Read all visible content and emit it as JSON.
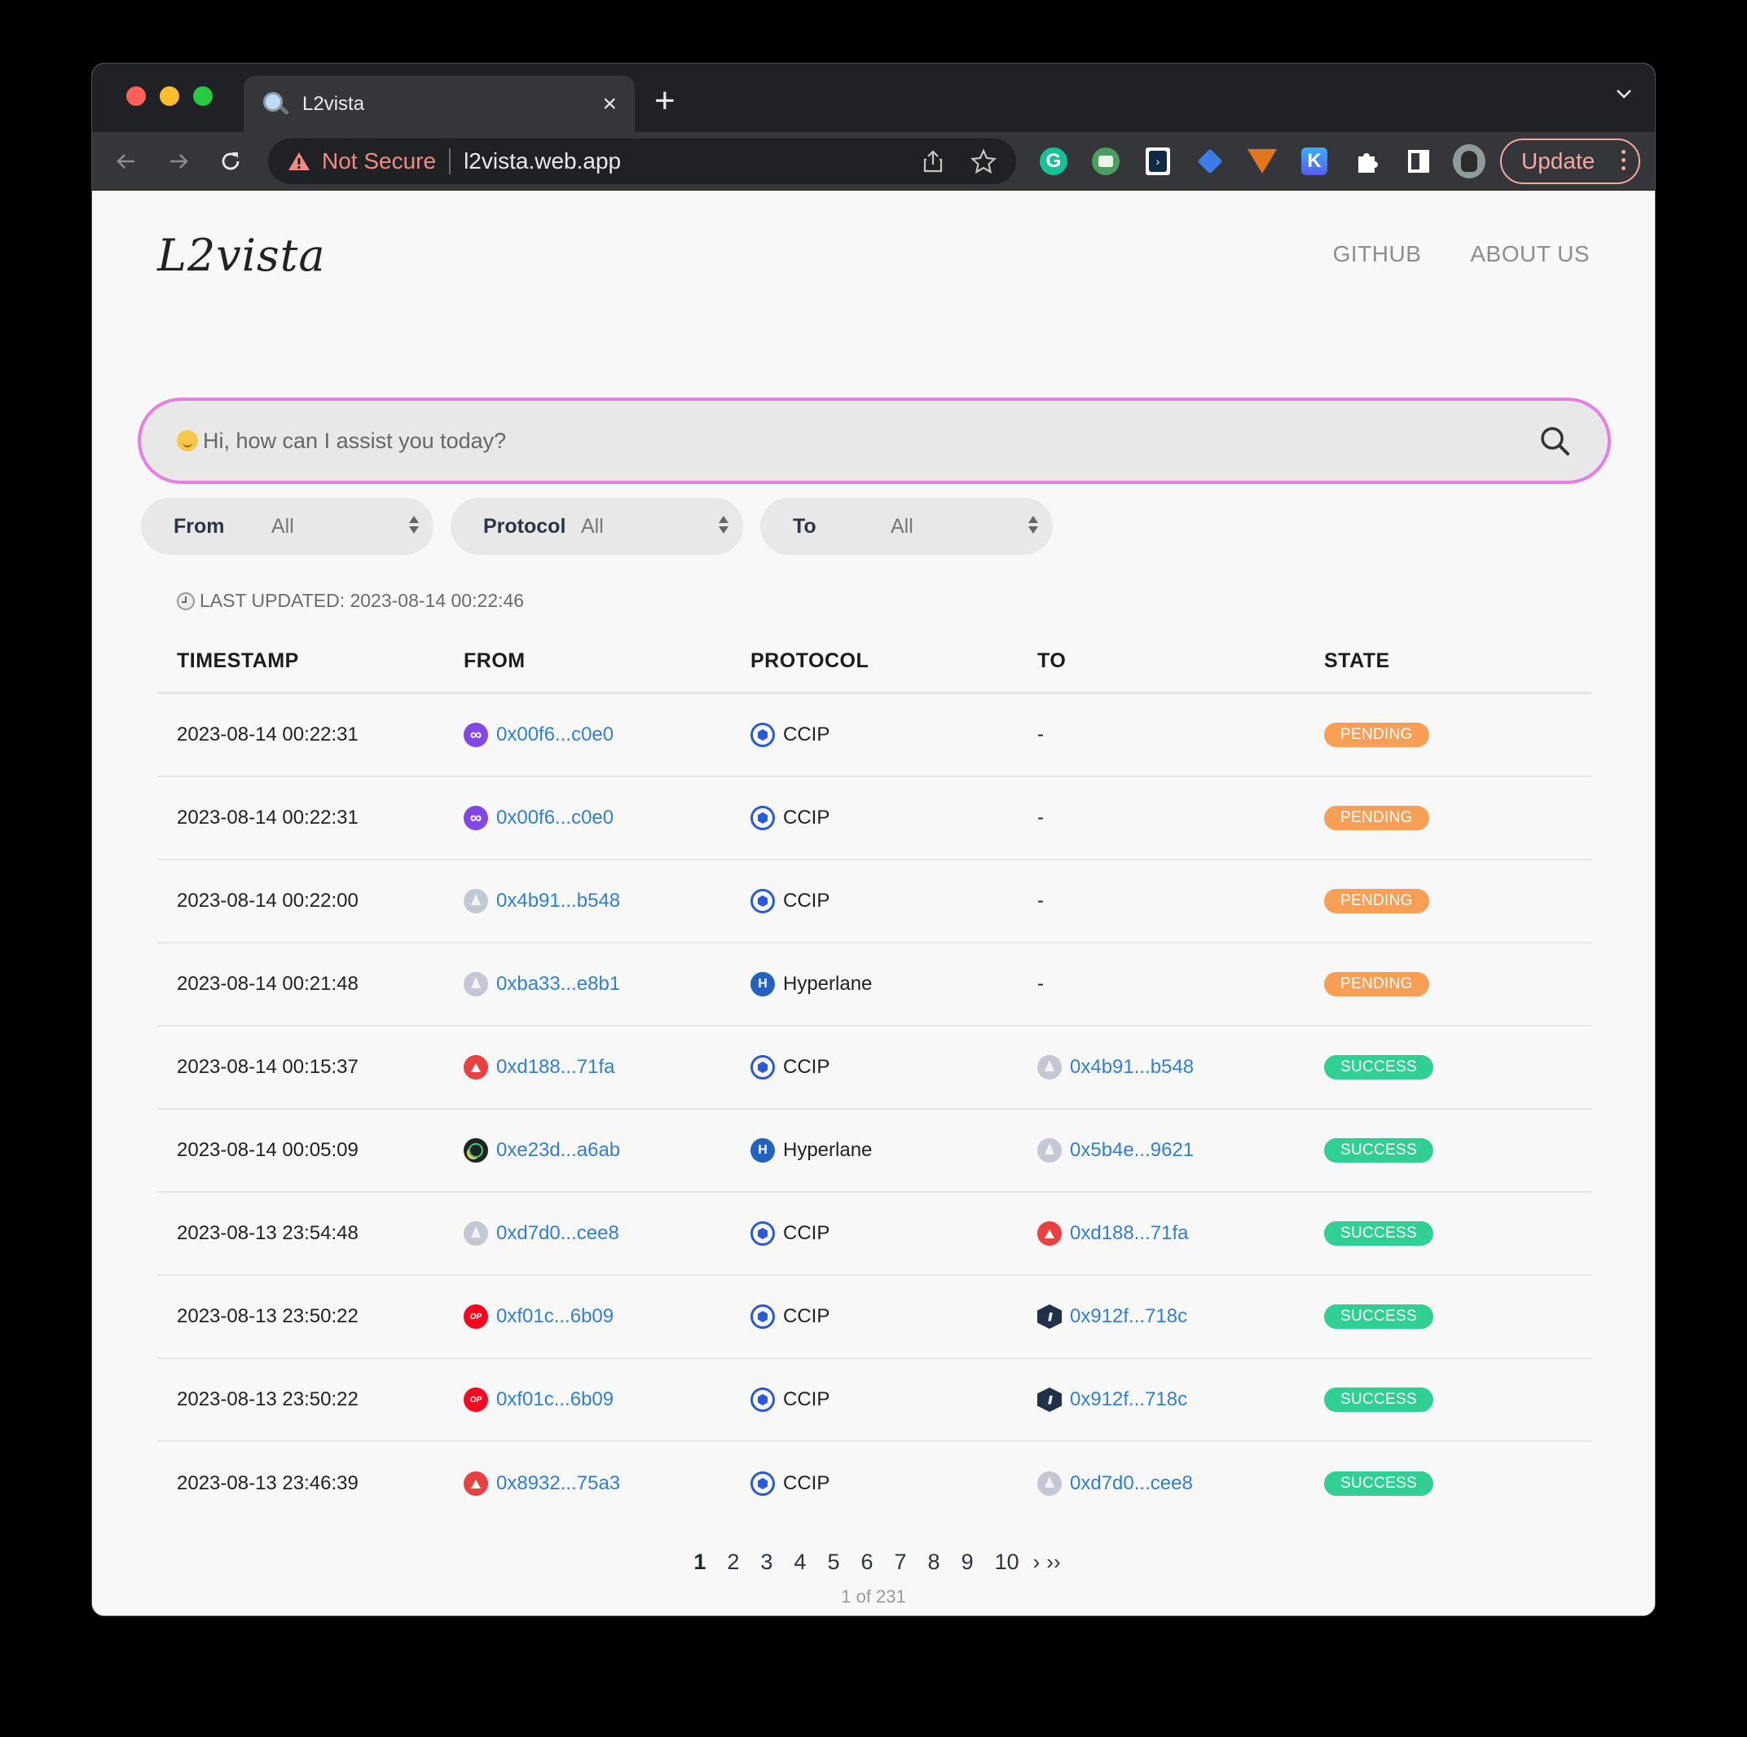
{
  "browser": {
    "tab_title": "L2vista",
    "tab_close": "×",
    "new_tab": "+",
    "security_label": "Not Secure",
    "url": "l2vista.web.app",
    "update_label": "Update",
    "extensions": [
      "grammarly-icon",
      "robot-extension-icon",
      "code-extension-icon",
      "diamond-extension-icon",
      "metamask-fox-icon",
      "k-extension-icon",
      "puzzle-extensions-icon",
      "side-panel-icon",
      "profile-avatar"
    ]
  },
  "header": {
    "logo": "L2vista",
    "nav": [
      {
        "label": "GITHUB"
      },
      {
        "label": "ABOUT US"
      }
    ]
  },
  "search": {
    "placeholder": "Hi, how can I assist you today?",
    "value": ""
  },
  "filters": [
    {
      "label": "From",
      "value": "All"
    },
    {
      "label": "Protocol",
      "value": "All"
    },
    {
      "label": "To",
      "value": "All"
    }
  ],
  "last_updated": "LAST UPDATED: 2023-08-14 00:22:46",
  "table": {
    "columns": [
      "TIMESTAMP",
      "FROM",
      "PROTOCOL",
      "TO",
      "STATE"
    ],
    "rows": [
      {
        "timestamp": "2023-08-14 00:22:31",
        "from_chain": "polygon",
        "from": "0x00f6...c0e0",
        "protocol_icon": "ccip",
        "protocol": "CCIP",
        "to_chain": "",
        "to": "-",
        "state": "PENDING"
      },
      {
        "timestamp": "2023-08-14 00:22:31",
        "from_chain": "polygon",
        "from": "0x00f6...c0e0",
        "protocol_icon": "ccip",
        "protocol": "CCIP",
        "to_chain": "",
        "to": "-",
        "state": "PENDING"
      },
      {
        "timestamp": "2023-08-14 00:22:00",
        "from_chain": "ethereum",
        "from": "0x4b91...b548",
        "protocol_icon": "ccip",
        "protocol": "CCIP",
        "to_chain": "",
        "to": "-",
        "state": "PENDING"
      },
      {
        "timestamp": "2023-08-14 00:21:48",
        "from_chain": "ethereum",
        "from": "0xba33...e8b1",
        "protocol_icon": "hyperlane",
        "protocol": "Hyperlane",
        "to_chain": "",
        "to": "-",
        "state": "PENDING"
      },
      {
        "timestamp": "2023-08-14 00:15:37",
        "from_chain": "avalanche",
        "from": "0xd188...71fa",
        "protocol_icon": "ccip",
        "protocol": "CCIP",
        "to_chain": "ethereum",
        "to": "0x4b91...b548",
        "state": "SUCCESS"
      },
      {
        "timestamp": "2023-08-14 00:05:09",
        "from_chain": "celo",
        "from": "0xe23d...a6ab",
        "protocol_icon": "hyperlane",
        "protocol": "Hyperlane",
        "to_chain": "ethereum",
        "to": "0x5b4e...9621",
        "state": "SUCCESS"
      },
      {
        "timestamp": "2023-08-13 23:54:48",
        "from_chain": "ethereum",
        "from": "0xd7d0...cee8",
        "protocol_icon": "ccip",
        "protocol": "CCIP",
        "to_chain": "avalanche",
        "to": "0xd188...71fa",
        "state": "SUCCESS"
      },
      {
        "timestamp": "2023-08-13 23:50:22",
        "from_chain": "optimism",
        "from": "0xf01c...6b09",
        "protocol_icon": "ccip",
        "protocol": "CCIP",
        "to_chain": "arbitrum",
        "to": "0x912f...718c",
        "state": "SUCCESS"
      },
      {
        "timestamp": "2023-08-13 23:50:22",
        "from_chain": "optimism",
        "from": "0xf01c...6b09",
        "protocol_icon": "ccip",
        "protocol": "CCIP",
        "to_chain": "arbitrum",
        "to": "0x912f...718c",
        "state": "SUCCESS"
      },
      {
        "timestamp": "2023-08-13 23:46:39",
        "from_chain": "avalanche",
        "from": "0x8932...75a3",
        "protocol_icon": "ccip",
        "protocol": "CCIP",
        "to_chain": "ethereum",
        "to": "0xd7d0...cee8",
        "state": "SUCCESS"
      }
    ]
  },
  "pagination": {
    "pages": [
      "1",
      "2",
      "3",
      "4",
      "5",
      "6",
      "7",
      "8",
      "9",
      "10"
    ],
    "current": "1",
    "next": "›",
    "last": "››",
    "summary": "1 of 231"
  },
  "colors": {
    "accent_search_border": "#e77ee3",
    "link": "#2f7fd6",
    "pending": "#f99e55",
    "success": "#30cf93"
  }
}
